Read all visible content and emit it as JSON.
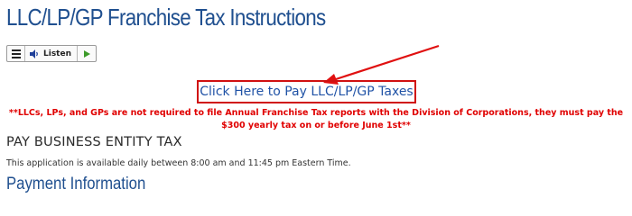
{
  "page": {
    "title": "LLC/LP/GP Franchise Tax Instructions"
  },
  "listen_toolbar": {
    "menu_icon": "hamburger-menu-icon",
    "listen_label": "Listen",
    "listen_icon": "speaker-icon",
    "play_icon": "play-icon",
    "play_color": "#3d9b2a"
  },
  "callout": {
    "pay_link": "Click Here to Pay LLC/LP/GP Taxes",
    "arrow_icon": "red-arrow-icon",
    "highlight_color": "#d01010",
    "notice": "**LLCs, LPs, and GPs are not required to file Annual Franchise Tax reports with the Division of Corporations, they must pay the $300 yearly tax on or before June 1st**",
    "notice_color": "#e00000"
  },
  "section": {
    "heading": "PAY BUSINESS ENTITY TAX",
    "availability": "This application is available daily between 8:00 am and 11:45 pm Eastern Time.",
    "payment_heading": "Payment Information"
  },
  "colors": {
    "heading_blue": "#1f4f8f",
    "link_blue": "#2153a6"
  }
}
